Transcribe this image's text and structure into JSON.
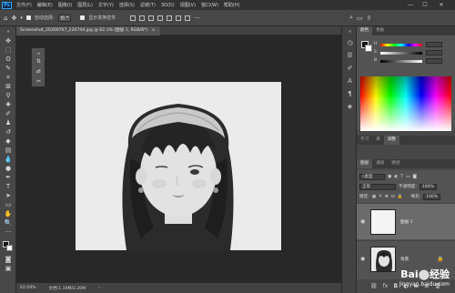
{
  "app": {
    "logo": "Ps"
  },
  "menu": [
    "文件(F)",
    "编辑(E)",
    "图像(I)",
    "图层(L)",
    "文字(Y)",
    "选择(S)",
    "滤镜(T)",
    "3D(D)",
    "视图(V)",
    "窗口(W)",
    "帮助(H)"
  ],
  "window_controls": {
    "minimize": "—",
    "maximize": "☐",
    "close": "✕"
  },
  "options_bar": {
    "auto_select_label": "自动选择:",
    "auto_select_value": "组",
    "show_transform_label": "显示变换控件"
  },
  "document_tab": {
    "title": "Screenshot_20200707_220744.jpg @ 62.1% (图层 1, RGB/8*)",
    "close": "×"
  },
  "status_bar": {
    "zoom": "62.09%",
    "doc_info": "文档:1.19M/2.20M"
  },
  "panels": {
    "color_tabs": [
      "颜色",
      "色板"
    ],
    "color_channels": [
      {
        "label": "H",
        "value": ""
      },
      {
        "label": "S",
        "value": ""
      },
      {
        "label": "B",
        "value": ""
      }
    ],
    "adjust_tabs": [
      "学习",
      "库",
      "调整"
    ],
    "layers_tabs": [
      "图层",
      "通道",
      "路径"
    ],
    "layers": {
      "filter_label": "类型",
      "blend_mode": "正常",
      "opacity_label": "不透明度:",
      "opacity_value": "100%",
      "lock_label": "锁定:",
      "fill_label": "填充:",
      "fill_value": "100%",
      "items": [
        {
          "name": "图层 1",
          "selected": true
        },
        {
          "name": "背景",
          "selected": false
        }
      ]
    }
  },
  "watermark": {
    "brand": "Bai",
    "brand2": "经验",
    "url": "jingyan.baidu.com"
  },
  "colors": {
    "accent": "#31a8ff",
    "panel_bg": "#535353",
    "canvas_bg": "#282828"
  }
}
